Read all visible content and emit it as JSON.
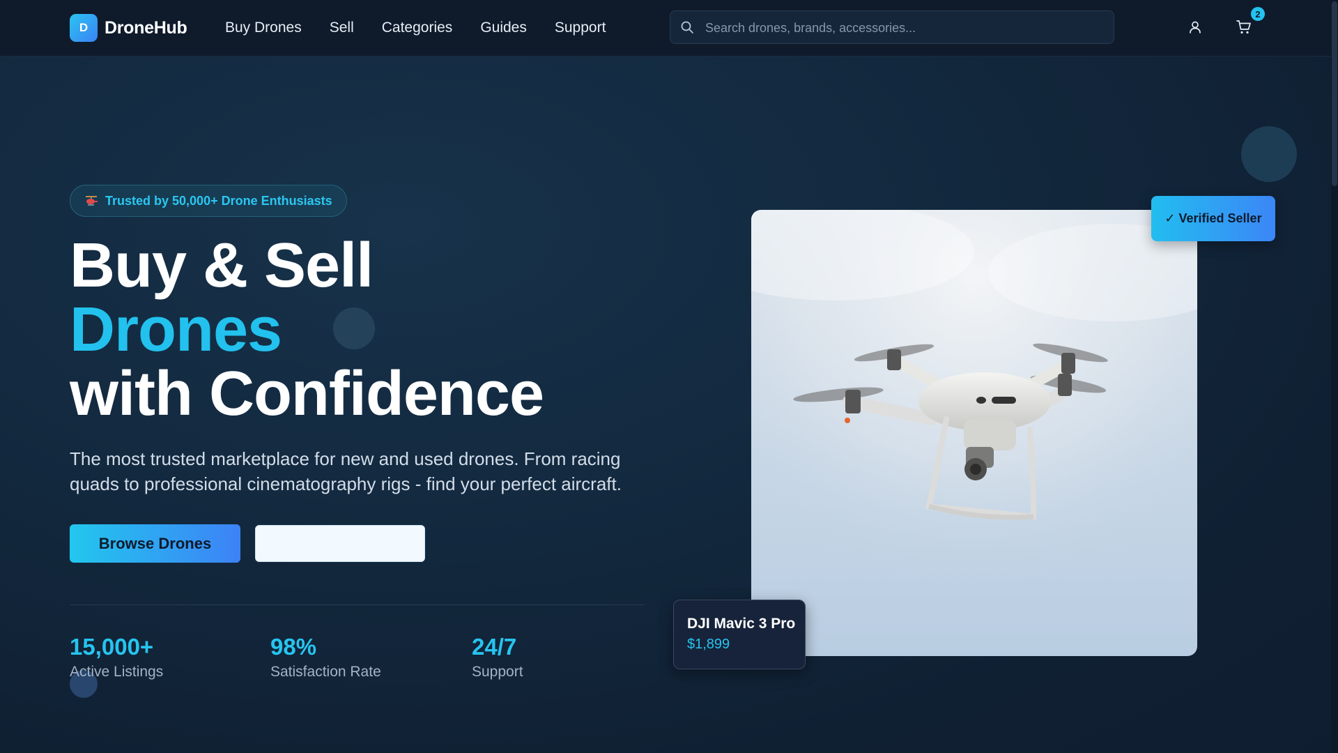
{
  "brand": {
    "badge_letter": "D",
    "name": "DroneHub"
  },
  "nav": {
    "links": [
      "Buy Drones",
      "Sell",
      "Categories",
      "Guides",
      "Support"
    ]
  },
  "search": {
    "placeholder": "Search drones, brands, accessories...",
    "value": ""
  },
  "header_icons": {
    "user": "user-icon",
    "cart": "cart-icon"
  },
  "cart": {
    "count": "2"
  },
  "hero": {
    "badge_text": "Trusted by 50,000+ Drone Enthusiasts",
    "badge_icon": "helicopter-icon",
    "headline_line1": "Buy & Sell",
    "headline_line2": "Drones",
    "headline_line3": "with Confidence",
    "lead": "The most trusted marketplace for new and used drones. From racing quads to professional cinematography rigs - find your perfect aircraft.",
    "primary_button": "Browse Drones",
    "secondary_button": ""
  },
  "stats": [
    {
      "value": "15,000+",
      "label": "Active Listings"
    },
    {
      "value": "98%",
      "label": "Satisfaction Rate"
    },
    {
      "value": "24/7",
      "label": "Support"
    }
  ],
  "featured": {
    "verified_label": "✓ Verified Seller",
    "product_name": "DJI Mavic 3 Pro",
    "product_price": "$1,899"
  },
  "colors": {
    "accent": "#22c1ee",
    "accent_blue": "#3b82f6",
    "background": "#132a40",
    "nav_background": "#0f1a2b"
  }
}
